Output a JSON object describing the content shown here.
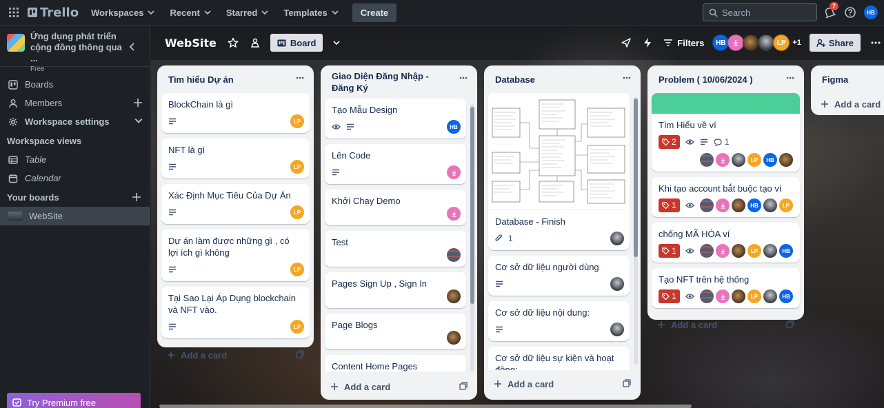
{
  "topnav": {
    "brand": "Trello",
    "menu": [
      {
        "label": "Workspaces"
      },
      {
        "label": "Recent"
      },
      {
        "label": "Starred"
      },
      {
        "label": "Templates"
      }
    ],
    "create_label": "Create",
    "search_placeholder": "Search",
    "notification_count": "7",
    "user_initials": "HB"
  },
  "sidebar": {
    "workspace_name": "Ứng dụng phát triển cộng đồng thông qua ...",
    "workspace_plan": "Free",
    "items": {
      "boards": "Boards",
      "members": "Members",
      "settings": "Workspace settings"
    },
    "views_heading": "Workspace views",
    "views": {
      "table": "Table",
      "calendar": "Calendar"
    },
    "your_boards_heading": "Your boards",
    "boards": [
      "WebSite"
    ],
    "premium_label": "Try Premium free"
  },
  "board": {
    "title": "WebSite",
    "view_label": "Board",
    "filters_label": "Filters",
    "extra_members": "+1",
    "share_label": "Share",
    "member_initials": {
      "hb": "HB",
      "lp": "LP"
    }
  },
  "lists": [
    {
      "title": "Tìm hiểu Dự án",
      "cards": [
        {
          "title": "BlockChain là gì"
        },
        {
          "title": "NFT là gì"
        },
        {
          "title": "Xác Định Mục Tiêu Của Dự Án"
        },
        {
          "title": "Dự án làm được những gì , có lợi ích gì không"
        },
        {
          "title": "Tại Sao Lại Áp Dụng blockchain và NFT vào."
        }
      ],
      "add_label": "Add a card"
    },
    {
      "title": "Giao Diện Đăng Nhập - Đăng Ký",
      "cards": [
        {
          "title": "Tạo Mẫu Design"
        },
        {
          "title": "Lên Code"
        },
        {
          "title": "Khởi Chạy Demo"
        },
        {
          "title": "Test"
        },
        {
          "title": "Pages Sign Up , Sign In"
        },
        {
          "title": "Page Blogs"
        },
        {
          "title": "Content Home Pages"
        }
      ],
      "add_label": "Add a card"
    },
    {
      "title": "Database",
      "cards": [
        {
          "title": "Database - Finish",
          "attachments": "1"
        },
        {
          "title": "Cơ sở dữ liệu người dùng"
        },
        {
          "title": "Cơ sở dữ liệu nội dung:"
        },
        {
          "title": "Cơ sở dữ liệu sự kiện và hoạt động:"
        }
      ],
      "add_label": "Add a card"
    },
    {
      "title": "Problem ( 10/06/2024 )",
      "cover_color": "#4bce97",
      "cards": [
        {
          "title": "Tìm Hiểu về ví",
          "due": "2",
          "comments": "1"
        },
        {
          "title": "Khi tạo account bắt buộc tạo ví",
          "due": "1"
        },
        {
          "title": "chống MÃ HÓA ví",
          "due": "1"
        },
        {
          "title": "Tạo NFT trên hệ thống",
          "due": "1"
        }
      ],
      "add_label": "Add a card"
    },
    {
      "title": "Figma",
      "add_label": "Add a card"
    }
  ]
}
